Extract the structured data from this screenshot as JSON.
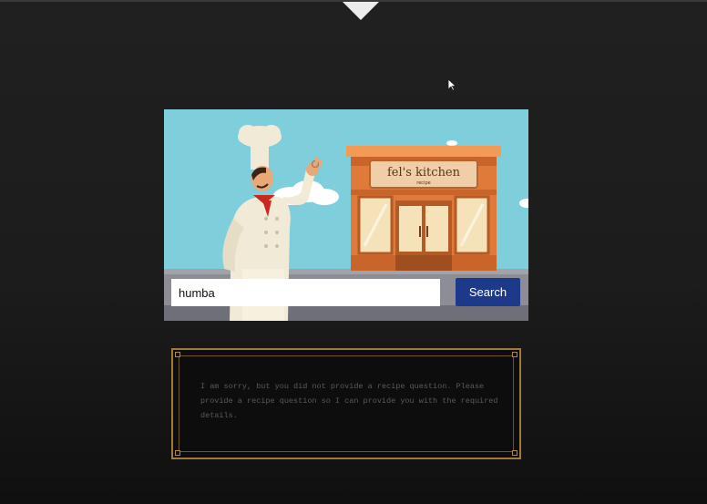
{
  "top_bar": {
    "toggle_icon": "triangle-down-icon"
  },
  "hero": {
    "sign_title": "fel's kitchen",
    "sign_subtitle": "recipe",
    "colors": {
      "sky": "#7ecfdb",
      "building": "#e07a3a",
      "sign": "#f0cfa8"
    }
  },
  "search": {
    "value": "humba",
    "placeholder": "",
    "button_label": "Search",
    "button_color": "#1d3a8a"
  },
  "result": {
    "message": "I am sorry, but you did not provide a recipe question. Please provide a recipe question so I can provide you with the required details.",
    "frame_color": "#a07a3a"
  }
}
